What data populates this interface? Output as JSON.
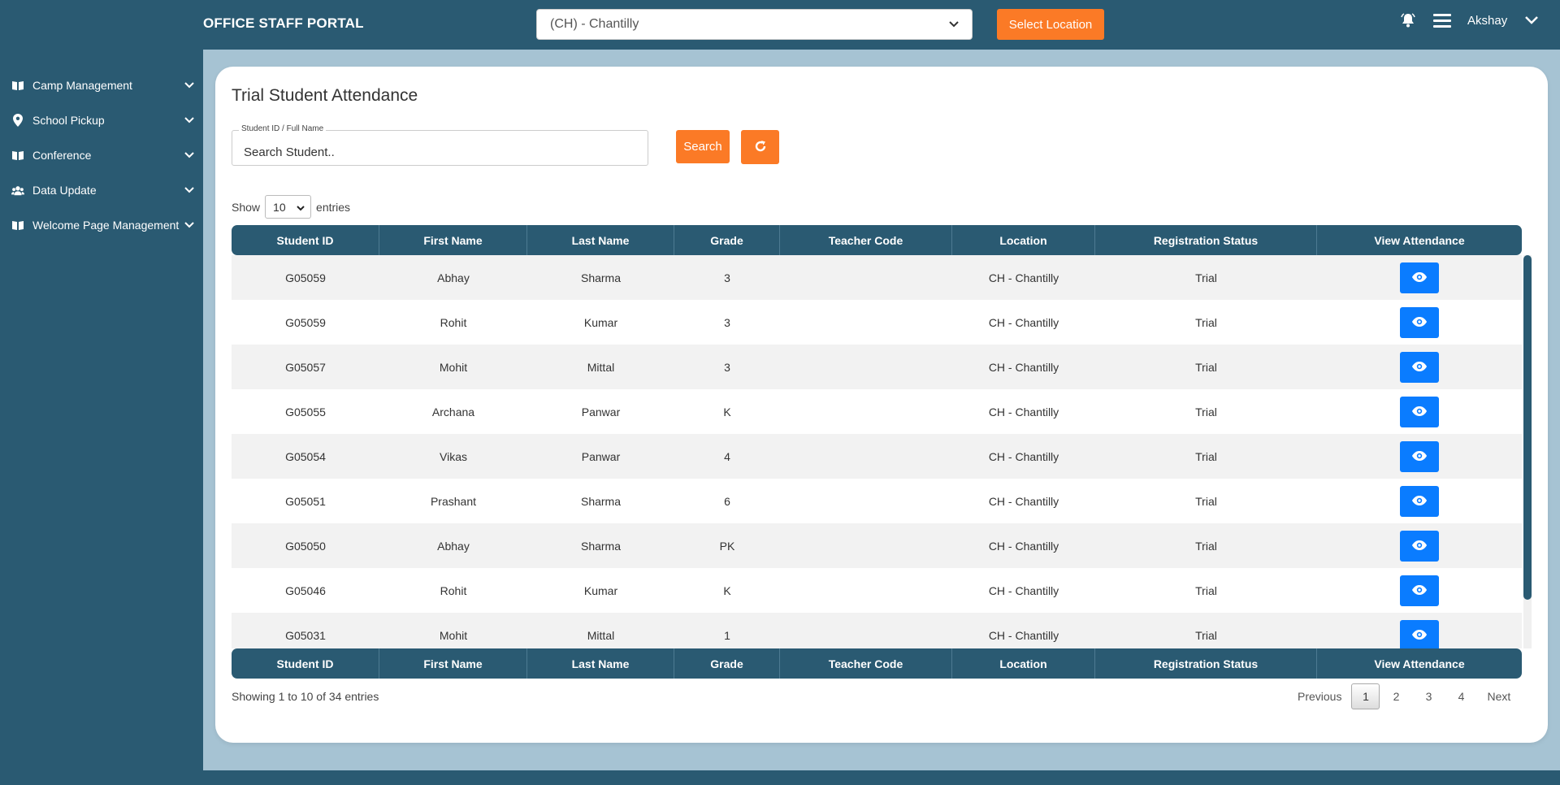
{
  "header": {
    "brand": "OFFICE STAFF PORTAL",
    "location_value": "(CH) - Chantilly",
    "select_location_label": "Select Location",
    "user_name": "Akshay"
  },
  "sidebar": {
    "items": [
      {
        "label": "Camp Management",
        "icon": "book-icon"
      },
      {
        "label": "School Pickup",
        "icon": "map-pin-icon"
      },
      {
        "label": "Conference",
        "icon": "book-icon"
      },
      {
        "label": "Data Update",
        "icon": "users-icon"
      },
      {
        "label": "Welcome Page Management",
        "icon": "book-icon"
      }
    ]
  },
  "main": {
    "title": "Trial Student Attendance",
    "search_legend": "Student ID / Full Name",
    "search_placeholder": "Search Student..",
    "search_label": "Search",
    "show_label": "Show",
    "entries_label": "entries",
    "page_length": "10"
  },
  "table": {
    "columns": [
      "Student ID",
      "First Name",
      "Last Name",
      "Grade",
      "Teacher Code",
      "Location",
      "Registration Status",
      "View Attendance"
    ],
    "rows": [
      {
        "id": "G05059",
        "first": "Abhay",
        "last": "Sharma",
        "grade": "3",
        "teacher": "",
        "location": "CH - Chantilly",
        "status": "Trial"
      },
      {
        "id": "G05059",
        "first": "Rohit",
        "last": "Kumar",
        "grade": "3",
        "teacher": "",
        "location": "CH - Chantilly",
        "status": "Trial"
      },
      {
        "id": "G05057",
        "first": "Mohit",
        "last": "Mittal",
        "grade": "3",
        "teacher": "",
        "location": "CH - Chantilly",
        "status": "Trial"
      },
      {
        "id": "G05055",
        "first": "Archana",
        "last": "Panwar",
        "grade": "K",
        "teacher": "",
        "location": "CH - Chantilly",
        "status": "Trial"
      },
      {
        "id": "G05054",
        "first": "Vikas",
        "last": "Panwar",
        "grade": "4",
        "teacher": "",
        "location": "CH - Chantilly",
        "status": "Trial"
      },
      {
        "id": "G05051",
        "first": "Prashant",
        "last": "Sharma",
        "grade": "6",
        "teacher": "",
        "location": "CH - Chantilly",
        "status": "Trial"
      },
      {
        "id": "G05050",
        "first": "Abhay",
        "last": "Sharma",
        "grade": "PK",
        "teacher": "",
        "location": "CH - Chantilly",
        "status": "Trial"
      },
      {
        "id": "G05046",
        "first": "Rohit",
        "last": "Kumar",
        "grade": "K",
        "teacher": "",
        "location": "CH - Chantilly",
        "status": "Trial"
      },
      {
        "id": "G05031",
        "first": "Mohit",
        "last": "Mittal",
        "grade": "1",
        "teacher": "",
        "location": "CH - Chantilly",
        "status": "Trial"
      }
    ],
    "view_icon": "eye-icon"
  },
  "footer": {
    "info": "Showing 1 to 10 of 34 entries",
    "previous": "Previous",
    "pages": [
      "1",
      "2",
      "3",
      "4"
    ],
    "active_page": "1",
    "next": "Next"
  },
  "colors": {
    "primary": "#2a5a72",
    "accent": "#fb7a26",
    "view_button": "#0a7cff",
    "content_bg": "#a6c3d3"
  }
}
